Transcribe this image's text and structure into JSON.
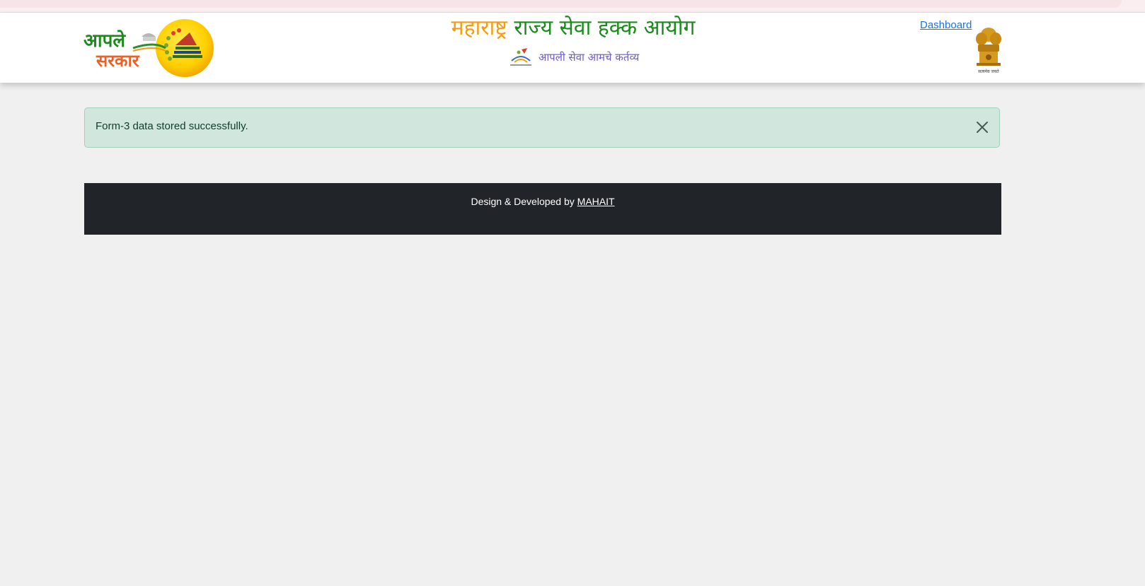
{
  "header": {
    "title_part1": "महाराष्ट्र",
    "title_part2": "राज्य सेवा हक्क आयोग",
    "subtitle": "आपली सेवा आमचे कर्तव्य",
    "logo_text_top": "आपले",
    "logo_text_bottom": "सरकार",
    "emblem_caption": "सत्यमेव जयते",
    "dashboard_link": "Dashboard"
  },
  "alert": {
    "message": "Form-3 data stored successfully.",
    "close_icon": "close-icon"
  },
  "footer": {
    "prefix": "Design & Developed by",
    "link": "MAHAIT"
  },
  "colors": {
    "title_orange": "#f39c12",
    "title_green": "#1e8a1e",
    "subtitle_purple": "#6a5acd",
    "alert_bg": "#d1e7dd",
    "footer_bg": "#212529",
    "link_blue": "#1a73e8"
  }
}
